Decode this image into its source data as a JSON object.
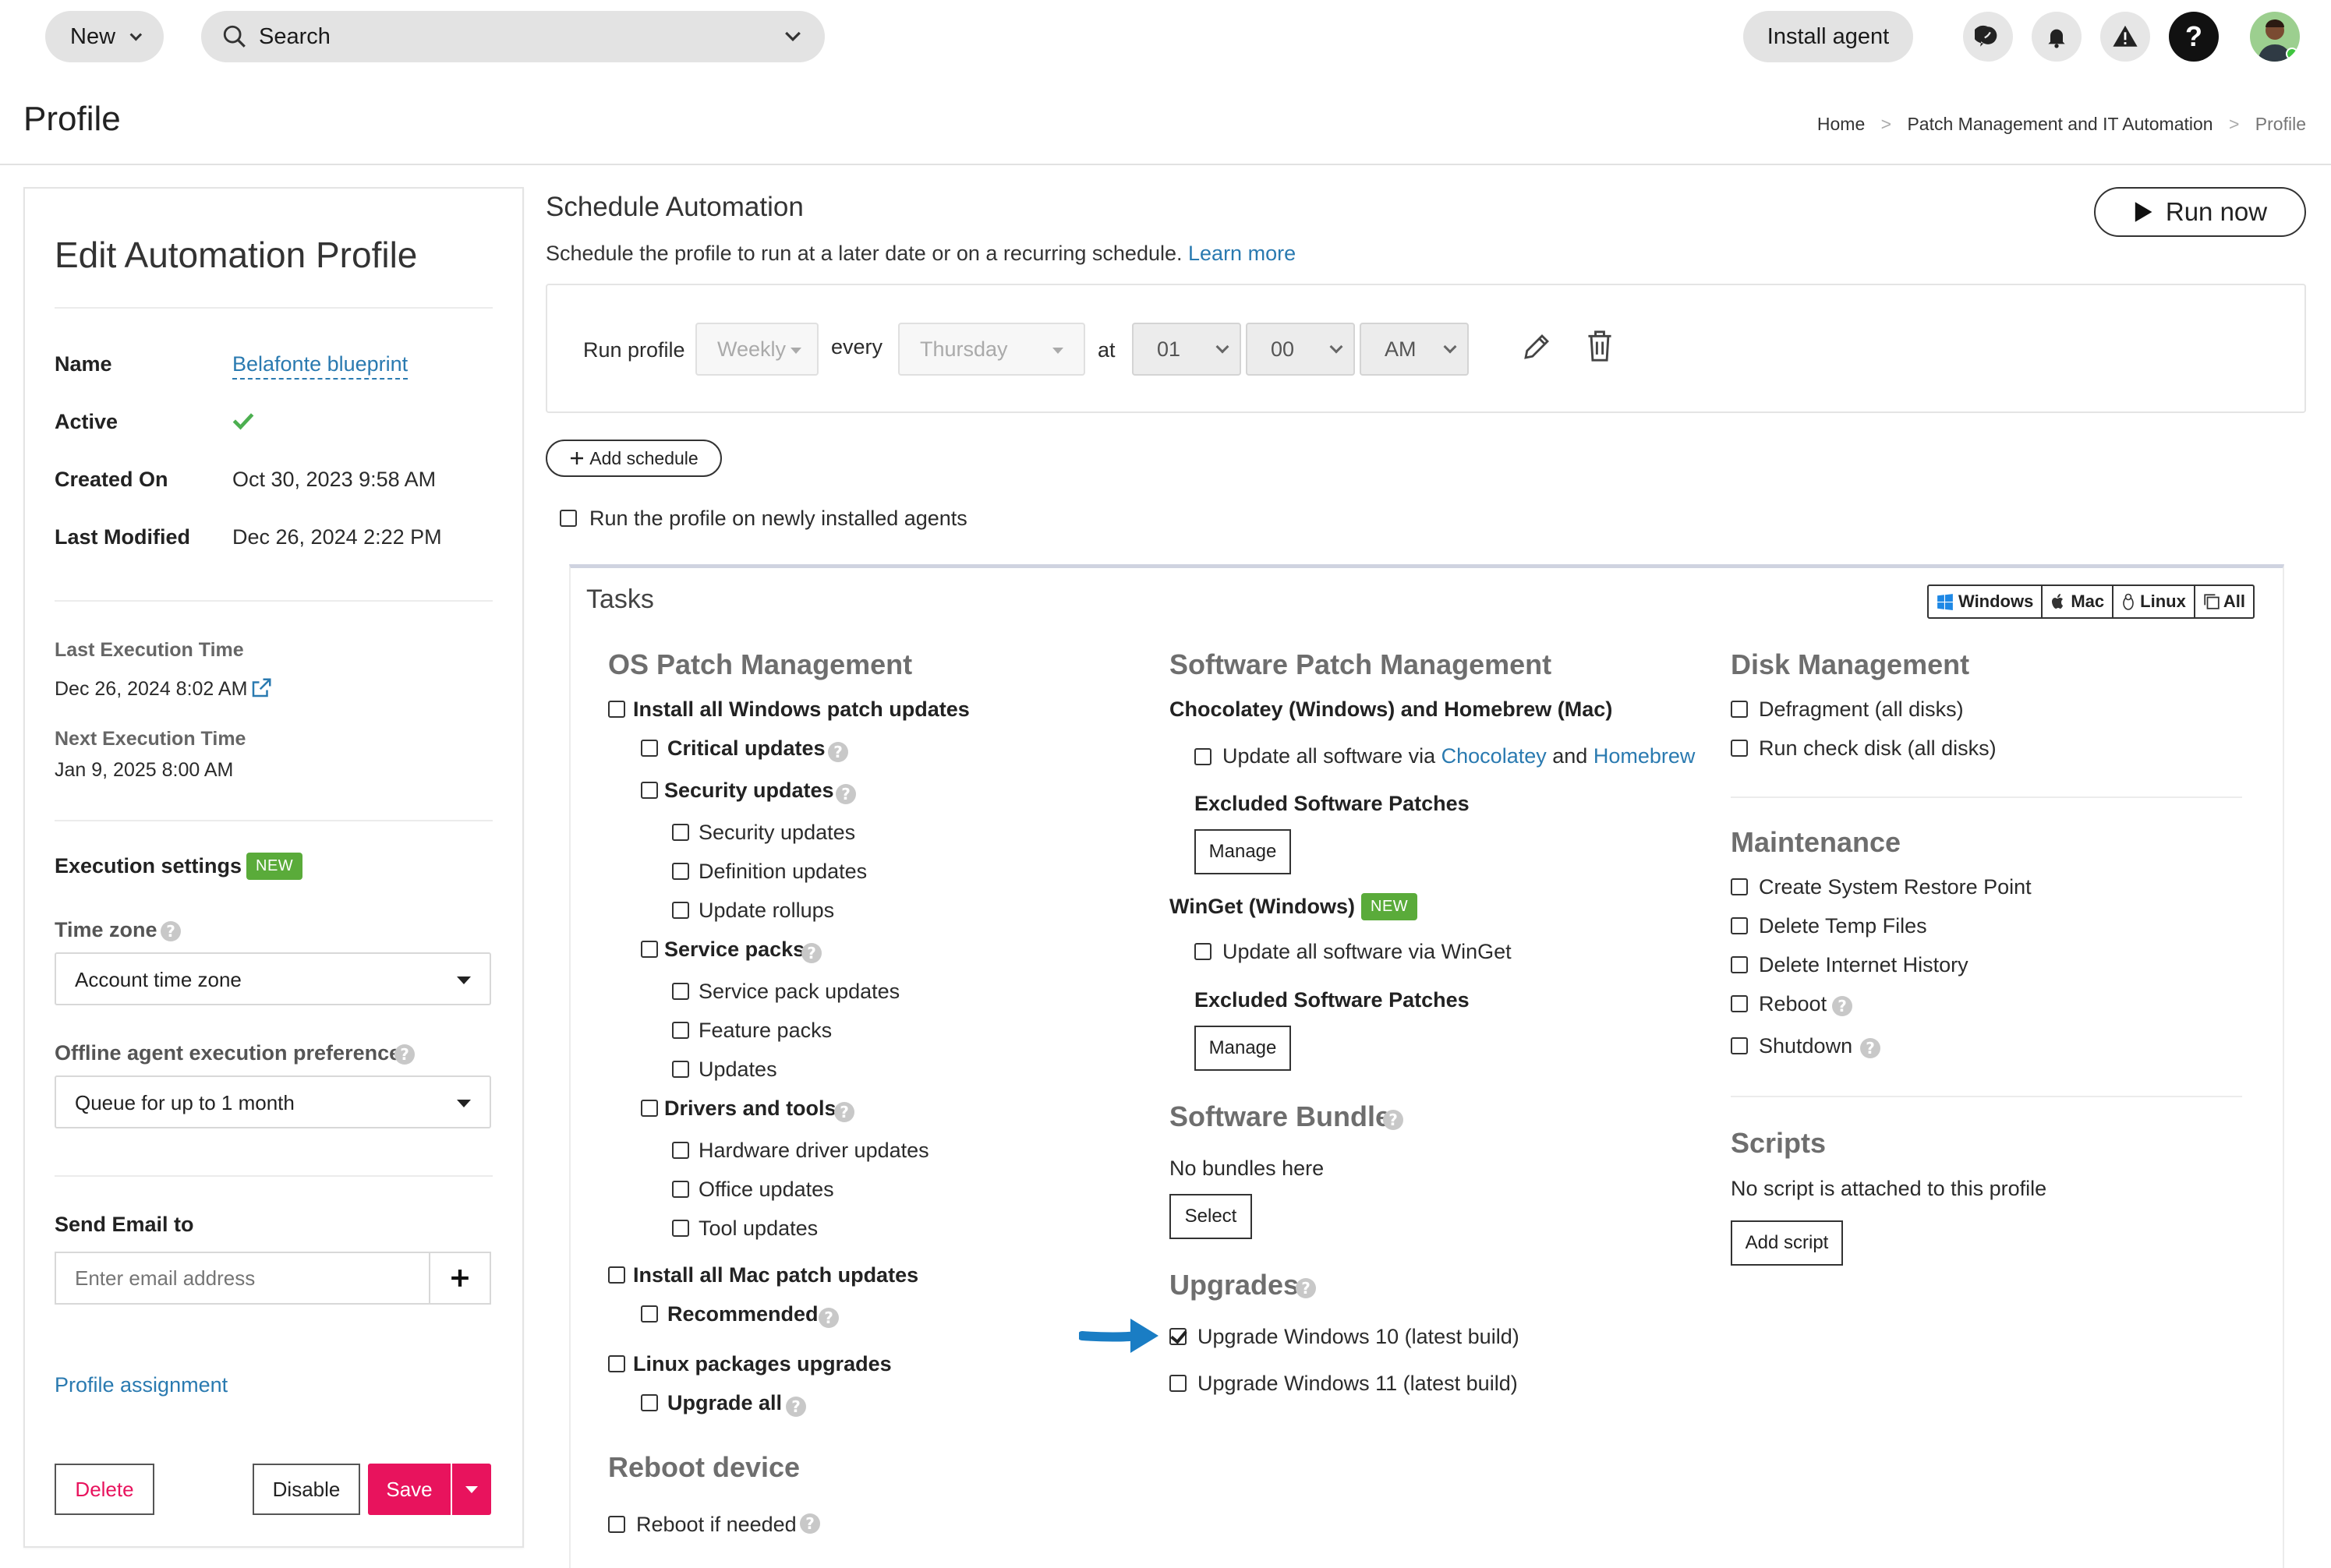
{
  "topbar": {
    "new_label": "New",
    "search_label": "Search",
    "install_agent_label": "Install agent"
  },
  "page": {
    "title": "Profile",
    "breadcrumb": [
      "Home",
      "Patch Management and IT Automation",
      "Profile"
    ]
  },
  "left_panel": {
    "heading": "Edit Automation Profile",
    "name_label": "Name",
    "name_value": "Belafonte blueprint",
    "active_label": "Active",
    "created_label": "Created On",
    "created_value": "Oct 30, 2023 9:58 AM",
    "modified_label": "Last Modified",
    "modified_value": "Dec 26, 2024 2:22 PM",
    "last_exec_label": "Last Execution Time",
    "last_exec_value": "Dec 26, 2024 8:02 AM",
    "next_exec_label": "Next Execution Time",
    "next_exec_value": "Jan 9, 2025 8:00 AM",
    "exec_settings_label": "Execution settings",
    "new_badge": "NEW",
    "timezone_label": "Time zone",
    "timezone_value": "Account time zone",
    "offline_label": "Offline agent execution preference",
    "offline_value": "Queue for up to 1 month",
    "email_label": "Send Email to",
    "email_placeholder": "Enter email address",
    "profile_assignment": "Profile assignment",
    "delete_label": "Delete",
    "disable_label": "Disable",
    "save_label": "Save"
  },
  "schedule": {
    "heading": "Schedule Automation",
    "description": "Schedule the profile to run at a later date or on a recurring schedule.",
    "learn_more": "Learn more",
    "run_now": "Run now",
    "run_profile_label": "Run profile",
    "frequency": "Weekly",
    "every_label": "every",
    "day": "Thursday",
    "at_label": "at",
    "hour": "01",
    "minute": "00",
    "ampm": "AM",
    "add_schedule": "Add schedule",
    "newly_installed": "Run the profile on newly installed agents"
  },
  "tasks": {
    "heading": "Tasks",
    "os_filters": [
      "Windows",
      "Mac",
      "Linux",
      "All"
    ],
    "os_patch": {
      "heading": "OS Patch Management",
      "install_windows": "Install all Windows patch updates",
      "critical": "Critical updates",
      "security": "Security updates",
      "security_items": [
        "Security updates",
        "Definition updates",
        "Update rollups"
      ],
      "service_packs": "Service packs",
      "service_items": [
        "Service pack updates",
        "Feature packs",
        "Updates"
      ],
      "drivers": "Drivers and tools",
      "driver_items": [
        "Hardware driver updates",
        "Office updates",
        "Tool updates"
      ],
      "install_mac": "Install all Mac patch updates",
      "recommended": "Recommended",
      "linux": "Linux packages upgrades",
      "upgrade_all": "Upgrade all"
    },
    "reboot": {
      "heading": "Reboot device",
      "if_needed": "Reboot if needed"
    },
    "software_patch": {
      "heading": "Software Patch Management",
      "choco_heading": "Chocolatey (Windows) and Homebrew (Mac)",
      "update_via": "Update all software via",
      "chocolatey": "Chocolatey",
      "and": "and",
      "homebrew": "Homebrew",
      "excluded": "Excluded Software Patches",
      "manage": "Manage",
      "winget_heading": "WinGet (Windows)",
      "winget_update": "Update all software via WinGet"
    },
    "bundle": {
      "heading": "Software Bundle",
      "empty": "No bundles here",
      "select": "Select"
    },
    "upgrades": {
      "heading": "Upgrades",
      "win10": "Upgrade Windows 10 (latest build)",
      "win10_checked": true,
      "win11": "Upgrade Windows 11 (latest build)"
    },
    "disk": {
      "heading": "Disk Management",
      "items": [
        "Defragment (all disks)",
        "Run check disk (all disks)"
      ]
    },
    "maintenance": {
      "heading": "Maintenance",
      "items": [
        "Create System Restore Point",
        "Delete Temp Files",
        "Delete Internet History",
        "Reboot",
        "Shutdown"
      ]
    },
    "scripts": {
      "heading": "Scripts",
      "empty": "No script is attached to this profile",
      "add": "Add script"
    }
  },
  "colors": {
    "accent_pink": "#e8135d",
    "link_blue": "#2a7ab0",
    "badge_green": "#5aab3a",
    "arrow_blue": "#1a7dc4"
  }
}
